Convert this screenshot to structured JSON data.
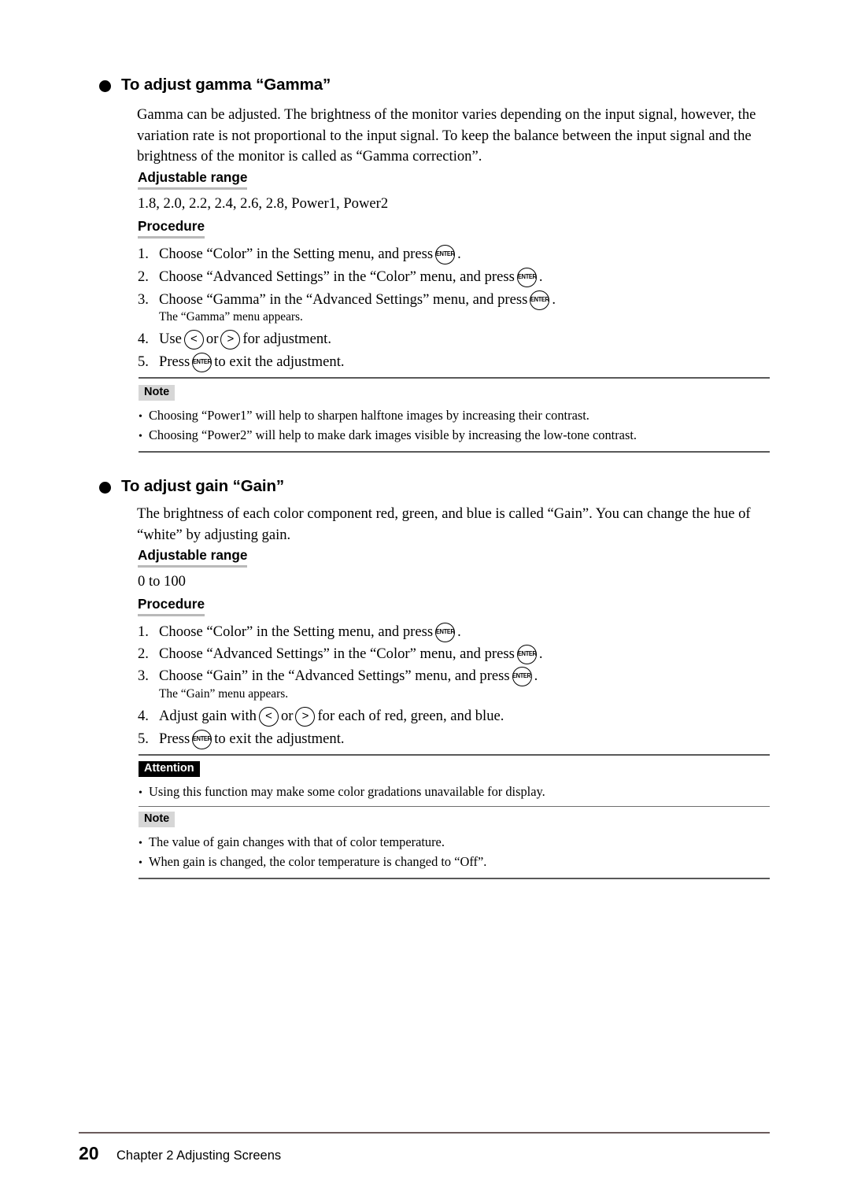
{
  "page": {
    "number": "20",
    "chapter": "Chapter 2 Adjusting Screens"
  },
  "icons": {
    "enter_label": "ENTER",
    "left_arrow": "<",
    "right_arrow": ">"
  },
  "labels": {
    "adjustable_range": "Adjustable range",
    "procedure": "Procedure",
    "note": "Note",
    "attention": "Attention",
    "bullet": "•"
  },
  "sections": [
    {
      "id": "gamma",
      "title": "To adjust gamma “Gamma”",
      "paragraph": "Gamma can be adjusted. The brightness of the monitor varies depending on the input signal, however, the variation rate is not proportional to the input signal. To keep the balance between the input signal and the brightness of the monitor is called as “Gamma correction”.",
      "range_value": "1.8, 2.0, 2.2, 2.4, 2.6, 2.8, Power1, Power2",
      "steps": [
        {
          "num": "1.",
          "pre": "Choose “Color” in the Setting menu, and press",
          "key": "enter",
          "post": "."
        },
        {
          "num": "2.",
          "pre": "Choose “Advanced Settings” in the “Color” menu, and press",
          "key": "enter",
          "post": "."
        },
        {
          "num": "3.",
          "pre": "Choose “Gamma” in the “Advanced Settings” menu, and press",
          "key": "enter",
          "post": "."
        },
        {
          "num": "4.",
          "pre": "Use",
          "key": "arrows",
          "mid": "or",
          "post": "for adjustment."
        },
        {
          "num": "5.",
          "pre": "Press",
          "key": "enter",
          "post": "to exit the adjustment."
        }
      ],
      "step_note": "The “Gamma” menu appears.",
      "callouts": [
        {
          "type": "note",
          "badge": "Note",
          "items": [
            "Choosing “Power1” will help to sharpen halftone images by increasing their contrast.",
            "Choosing “Power2” will help to make dark images visible by increasing the low-tone contrast."
          ]
        }
      ]
    },
    {
      "id": "gain",
      "title": "To adjust gain “Gain”",
      "paragraph": "The brightness of each color component red, green, and blue is called “Gain”. You can change the hue of “white” by adjusting gain.",
      "range_value": "0 to 100",
      "steps": [
        {
          "num": "1.",
          "pre": "Choose “Color” in the Setting menu, and press",
          "key": "enter",
          "post": "."
        },
        {
          "num": "2.",
          "pre": "Choose “Advanced Settings” in the “Color” menu, and press",
          "key": "enter",
          "post": "."
        },
        {
          "num": "3.",
          "pre": "Choose “Gain” in the “Advanced Settings” menu, and press",
          "key": "enter",
          "post": "."
        },
        {
          "num": "4.",
          "pre": "Adjust gain with",
          "key": "arrows",
          "mid": "or",
          "post": "for each of red, green, and blue."
        },
        {
          "num": "5.",
          "pre": "Press",
          "key": "enter",
          "post": "to exit the adjustment."
        }
      ],
      "step_note": "The “Gain” menu appears.",
      "callouts": [
        {
          "type": "attention",
          "badge": "Attention",
          "items": [
            "Using this function may make some color gradations unavailable for display."
          ]
        },
        {
          "type": "note",
          "badge": "Note",
          "items": [
            "The value of gain changes with that of color temperature.",
            "When gain is changed, the color temperature is changed to “Off”."
          ]
        }
      ]
    }
  ],
  "colors": {
    "rule": "#595959",
    "underline": "#b9b9b9",
    "note_badge_bg": "#d6d6d6",
    "attention_badge_bg": "#000000",
    "footer_rule": "#6b5b5b"
  }
}
